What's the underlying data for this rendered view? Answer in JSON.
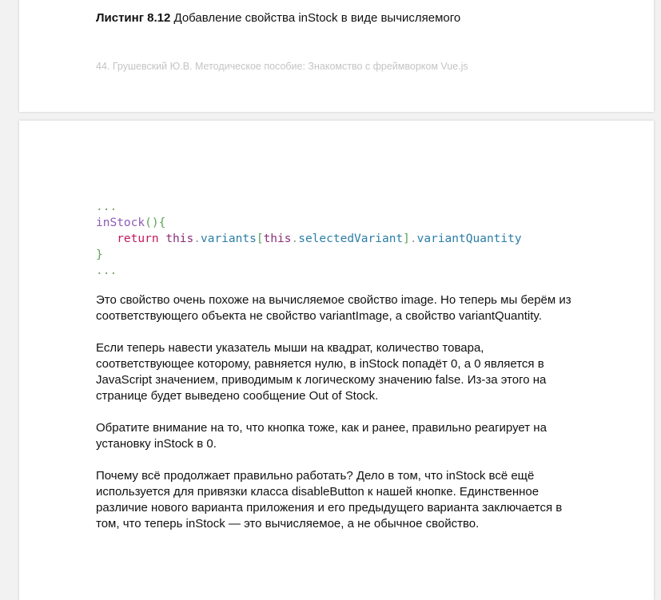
{
  "listing": {
    "label": "Листинг 8.12",
    "title": " Добавление свойства inStock в виде вычисляемого"
  },
  "footer": "44. Грушевский Ю.В. Методическое пособие: Знакомство с фреймворком Vue.js",
  "code": {
    "line1": "...",
    "line2_fn": "inStock",
    "line2_parens": "(){",
    "line3_indent": "   ",
    "line3_return": "return",
    "line3_this1": "this",
    "line3_dot1": ".",
    "line3_variants": "variants",
    "line3_lbr": "[",
    "line3_this2": "this",
    "line3_dot2": ".",
    "line3_selected": "selectedVariant",
    "line3_rbr": "]",
    "line3_dot3": ".",
    "line3_qty": "variantQuantity",
    "line4": "}",
    "line5": "..."
  },
  "paragraphs": {
    "p1": "Это свойство очень похоже на вычисляемое свойство image. Но теперь мы берём из соответствующего объекта не свойство variantImage, а свойство variantQuantity.",
    "p2": "Если теперь навести указатель мыши на квадрат, количество товара, соответствующее которому, равняется нулю, в inStock попадёт 0, а 0 является в JavaScript значением, приводимым к логическому значению false. Из-за этого на странице будет выведено сообщение Out of Stock.",
    "p3": "Обратите внимание на то, что кнопка тоже, как и ранее, правильно реагирует на установку inStock в 0.",
    "p4": "Почему всё продолжает правильно работать? Дело в том, что inStock всё ещё используется для привязки класса disableButton к нашей кнопке. Единственное различие нового варианта приложения и его предыдущего варианта заключается в том, что теперь inStock — это вычисляемое, а не обычное свойство."
  }
}
